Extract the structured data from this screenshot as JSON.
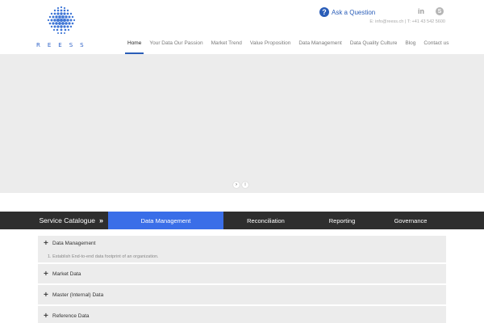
{
  "brand": {
    "logo_text": "REESS",
    "accent_color": "#2a5db8"
  },
  "header": {
    "ask_icon": "question-icon",
    "ask_icon_glyph": "?",
    "ask_label": "Ask a Question",
    "social": [
      {
        "icon": "linkedin-icon",
        "glyph": "in"
      },
      {
        "icon": "skype-icon",
        "glyph": "S"
      }
    ],
    "contact_line": "E: info@reess.ch | T: +41 43 542 5600"
  },
  "nav": [
    {
      "label": "Home",
      "active": true
    },
    {
      "label": "Your Data Our Passion"
    },
    {
      "label": "Market Trend"
    },
    {
      "label": "Value Proposition"
    },
    {
      "label": "Data Management"
    },
    {
      "label": "Data Quality Culture"
    },
    {
      "label": "Blog"
    },
    {
      "label": "Contact us"
    }
  ],
  "slider": {
    "next_glyph": "›",
    "pause_glyph": "II"
  },
  "service_bar": {
    "title": "Service Catalogue",
    "chevron": "»",
    "tabs": [
      {
        "label": "Data Management",
        "active": true,
        "color": "#3a6ee8"
      },
      {
        "label": "Reconciliation"
      },
      {
        "label": "Reporting"
      },
      {
        "label": "Governance"
      }
    ]
  },
  "accordion": [
    {
      "title": "Data Management",
      "expanded": true,
      "content": "1.  Establish End-to-end data footprint of an organization."
    },
    {
      "title": "Market Data"
    },
    {
      "title": "Master (Internal) Data"
    },
    {
      "title": "Reference Data"
    }
  ],
  "accordion_plus_glyph": "+"
}
